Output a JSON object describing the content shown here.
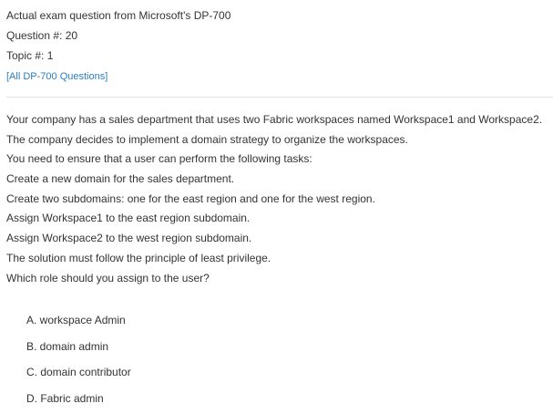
{
  "header": {
    "source_line": "Actual exam question from Microsoft's DP-700",
    "question_number": "Question #: 20",
    "topic": "Topic #: 1",
    "all_questions_link": "[All DP-700 Questions]"
  },
  "question": {
    "lines": [
      "Your company has a sales department that uses two Fabric workspaces named Workspace1 and Workspace2.",
      "The company decides to implement a domain strategy to organize the workspaces.",
      "You need to ensure that a user can perform the following tasks:",
      "Create a new domain for the sales department.",
      "Create two subdomains: one for the east region and one for the west region.",
      "Assign Workspace1 to the east region subdomain.",
      "Assign Workspace2 to the west region subdomain.",
      "The solution must follow the principle of least privilege.",
      "Which role should you assign to the user?"
    ]
  },
  "choices": [
    "A. workspace Admin",
    "B. domain admin",
    "C. domain contributor",
    "D. Fabric admin"
  ]
}
